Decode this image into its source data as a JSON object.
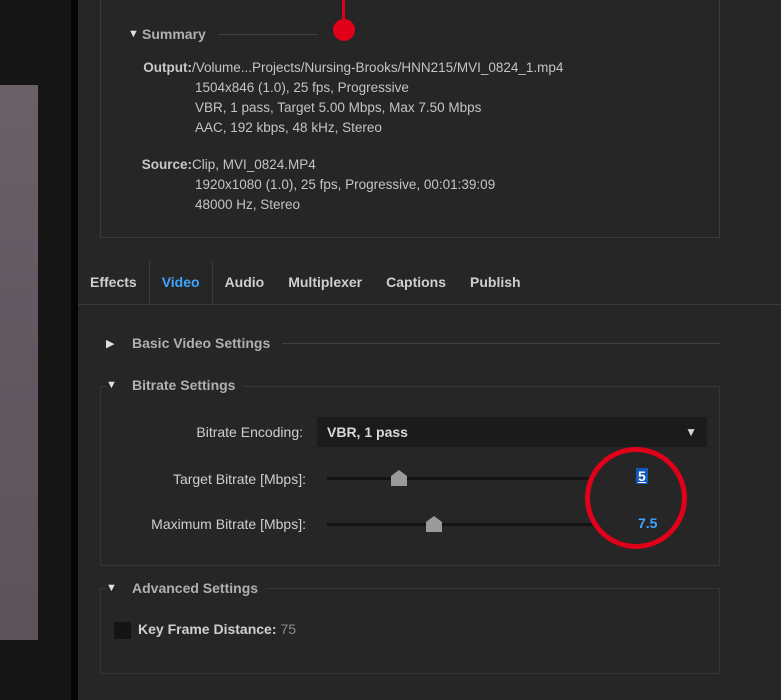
{
  "summary": {
    "title": "Summary",
    "output_label": "Output:",
    "output_lines": [
      "/Volume...Projects/Nursing-Brooks/HNN215/MVI_0824_1.mp4",
      "1504x846 (1.0), 25 fps, Progressive",
      "VBR, 1 pass, Target 5.00 Mbps, Max 7.50 Mbps",
      "AAC, 192 kbps, 48 kHz, Stereo"
    ],
    "source_label": "Source:",
    "source_lines": [
      "Clip, MVI_0824.MP4",
      "1920x1080 (1.0), 25 fps, Progressive, 00:01:39:09",
      "48000 Hz, Stereo"
    ]
  },
  "tabs": [
    {
      "label": "Effects",
      "active": false
    },
    {
      "label": "Video",
      "active": true
    },
    {
      "label": "Audio",
      "active": false
    },
    {
      "label": "Multiplexer",
      "active": false
    },
    {
      "label": "Captions",
      "active": false
    },
    {
      "label": "Publish",
      "active": false
    }
  ],
  "basic_video": {
    "title": "Basic Video Settings"
  },
  "bitrate": {
    "title": "Bitrate Settings",
    "encoding_label": "Bitrate Encoding:",
    "encoding_value": "VBR, 1 pass",
    "target_label": "Target Bitrate [Mbps]:",
    "target_value": "5",
    "target_fraction": 0.27,
    "max_label": "Maximum Bitrate [Mbps]:",
    "max_value": "7.5",
    "max_fraction": 0.4
  },
  "advanced": {
    "title": "Advanced Settings",
    "keyframe_label": "Key Frame Distance:",
    "keyframe_value": "75"
  },
  "colors": {
    "accent": "#3ea6ff",
    "annotation": "#e0001a",
    "panel_bg": "#262626"
  }
}
